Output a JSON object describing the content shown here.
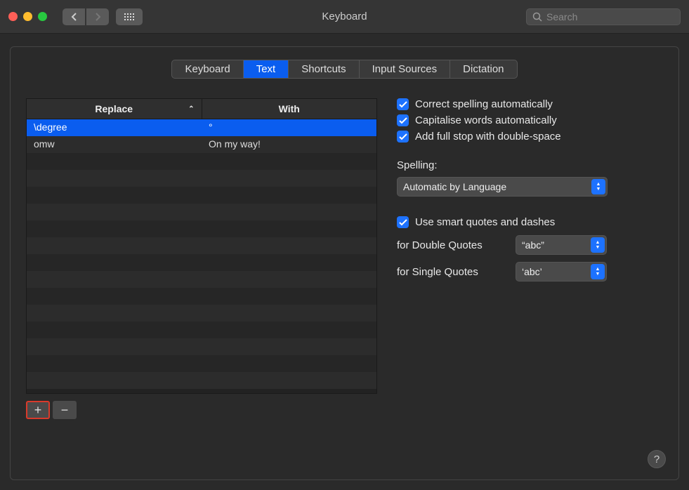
{
  "window": {
    "title": "Keyboard"
  },
  "search": {
    "placeholder": "Search"
  },
  "tabs": [
    {
      "label": "Keyboard",
      "active": false
    },
    {
      "label": "Text",
      "active": true
    },
    {
      "label": "Shortcuts",
      "active": false
    },
    {
      "label": "Input Sources",
      "active": false
    },
    {
      "label": "Dictation",
      "active": false
    }
  ],
  "table": {
    "headers": {
      "replace": "Replace",
      "with": "With"
    },
    "rows": [
      {
        "replace": "\\degree",
        "with": "°",
        "selected": true
      },
      {
        "replace": "omw",
        "with": "On my way!",
        "selected": false
      }
    ],
    "empty_rows": 14
  },
  "buttons": {
    "add": "+",
    "remove": "−"
  },
  "options": {
    "correct_spelling": "Correct spelling automatically",
    "capitalise": "Capitalise words automatically",
    "full_stop": "Add full stop with double-space",
    "spelling_label": "Spelling:",
    "spelling_value": "Automatic by Language",
    "smart_quotes": "Use smart quotes and dashes",
    "double_label": "for Double Quotes",
    "double_value": "“abc”",
    "single_label": "for Single Quotes",
    "single_value": "‘abc’"
  },
  "help": "?"
}
